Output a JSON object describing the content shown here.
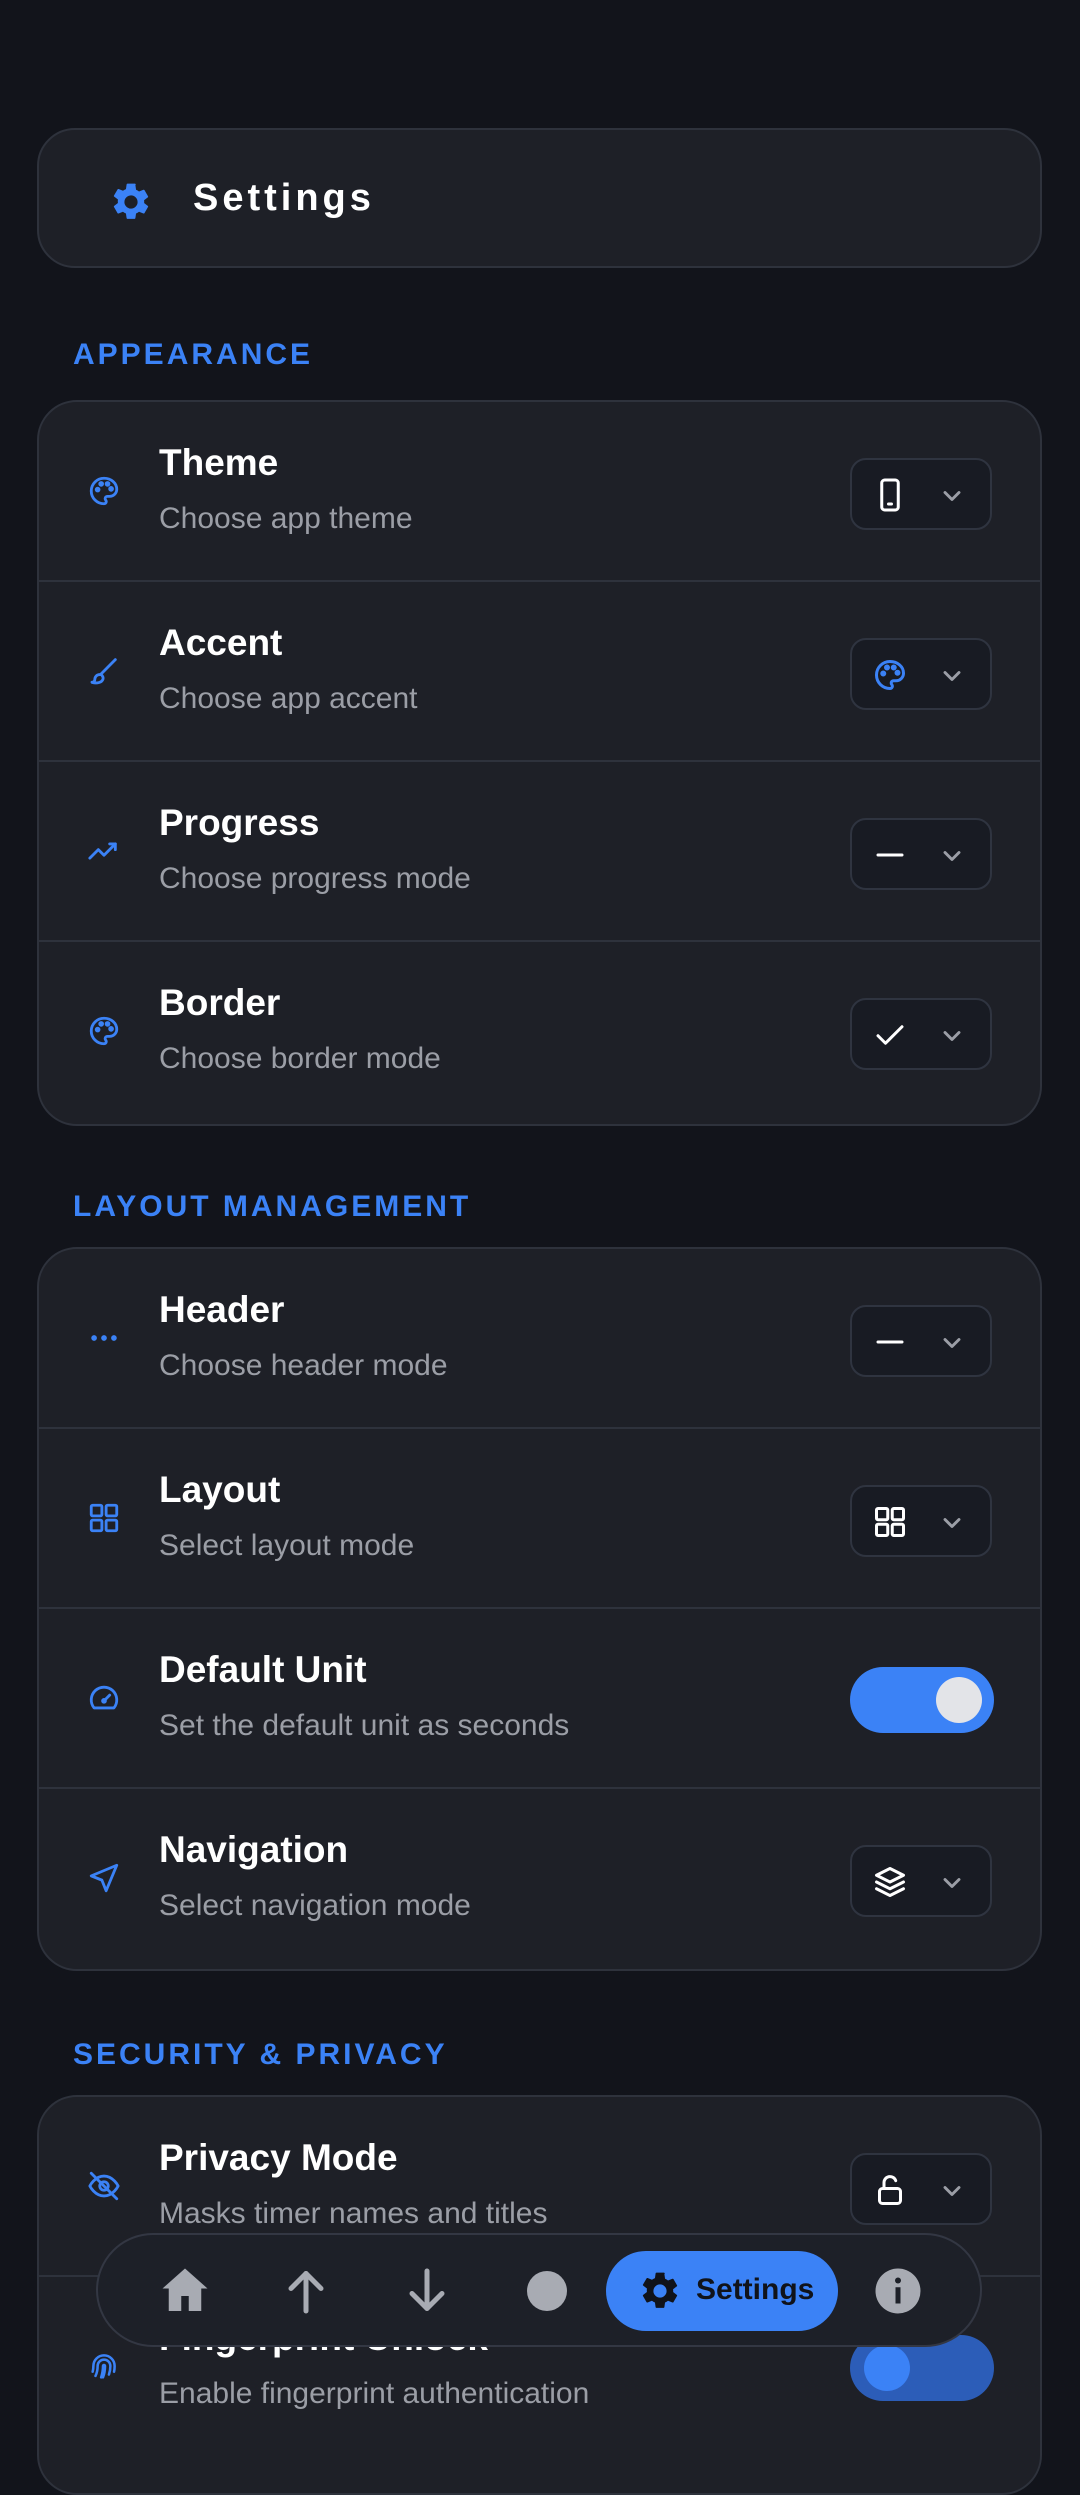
{
  "header": {
    "title": "Settings",
    "icon": "gear-icon"
  },
  "colors": {
    "accent": "#3b82f6",
    "background": "#12141b",
    "card": "#1e2027"
  },
  "sections": {
    "appearance": {
      "title": "APPEARANCE",
      "rows": [
        {
          "title": "Theme",
          "subtitle": "Choose app theme",
          "icon": "palette-icon",
          "control": "dropdown",
          "value_icon": "phone-icon"
        },
        {
          "title": "Accent",
          "subtitle": "Choose app accent",
          "icon": "brush-icon",
          "control": "dropdown",
          "value_icon": "palette-icon"
        },
        {
          "title": "Progress",
          "subtitle": "Choose progress mode",
          "icon": "trend-icon",
          "control": "dropdown",
          "value_icon": "dash-icon"
        },
        {
          "title": "Border",
          "subtitle": "Choose border mode",
          "icon": "palette-icon",
          "control": "dropdown",
          "value_icon": "check-icon"
        }
      ]
    },
    "layout": {
      "title": "LAYOUT MANAGEMENT",
      "rows": [
        {
          "title": "Header",
          "subtitle": "Choose header mode",
          "icon": "dots-icon",
          "control": "dropdown",
          "value_icon": "dash-icon"
        },
        {
          "title": "Layout",
          "subtitle": "Select layout mode",
          "icon": "grid-icon",
          "control": "dropdown",
          "value_icon": "grid-icon"
        },
        {
          "title": "Default Unit",
          "subtitle": "Set the default unit as seconds",
          "icon": "gauge-icon",
          "control": "toggle",
          "on": true
        },
        {
          "title": "Navigation",
          "subtitle": "Select navigation mode",
          "icon": "navigation-arrow-icon",
          "control": "dropdown",
          "value_icon": "layers-icon"
        }
      ]
    },
    "security": {
      "title": "SECURITY & PRIVACY",
      "rows": [
        {
          "title": "Privacy Mode",
          "subtitle": "Masks timer names and titles",
          "icon": "eye-off-icon",
          "control": "dropdown",
          "value_icon": "lock-icon"
        },
        {
          "title": "Fingerprint Unlock",
          "subtitle": "Enable fingerprint authentication",
          "icon": "fingerprint-icon",
          "control": "toggle",
          "on": false
        }
      ]
    }
  },
  "nav": {
    "items": [
      "home-icon",
      "arrow-up-icon",
      "arrow-down-icon",
      "circle-icon",
      "gear-icon",
      "info-icon"
    ],
    "active_label": "Settings"
  }
}
